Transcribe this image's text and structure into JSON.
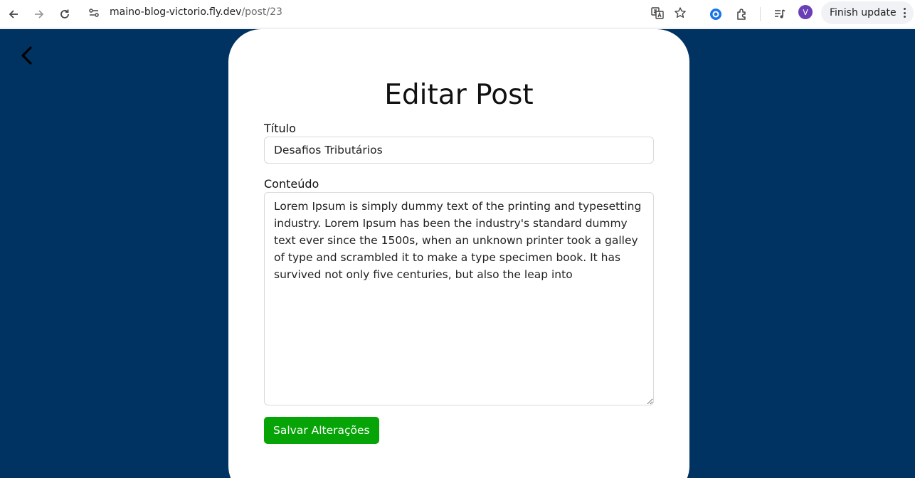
{
  "browser": {
    "url_host": "maino-blog-victorio.fly.dev",
    "url_path": "/post/23",
    "avatar_letter": "V",
    "finish_update_label": "Finish update"
  },
  "page": {
    "title": "Editar Post",
    "title_label": "Título",
    "title_value": "Desafios Tributários",
    "content_label": "Conteúdo",
    "content_value": "Lorem Ipsum is simply dummy text of the printing and typesetting industry. Lorem Ipsum has been the industry's standard dummy text ever since the 1500s, when an unknown printer took a galley of type and scrambled it to make a type specimen book. It has survived not only five centuries, but also the leap into",
    "save_label": "Salvar Alterações"
  },
  "colors": {
    "page_background": "#003362",
    "save_button": "#06a406"
  }
}
